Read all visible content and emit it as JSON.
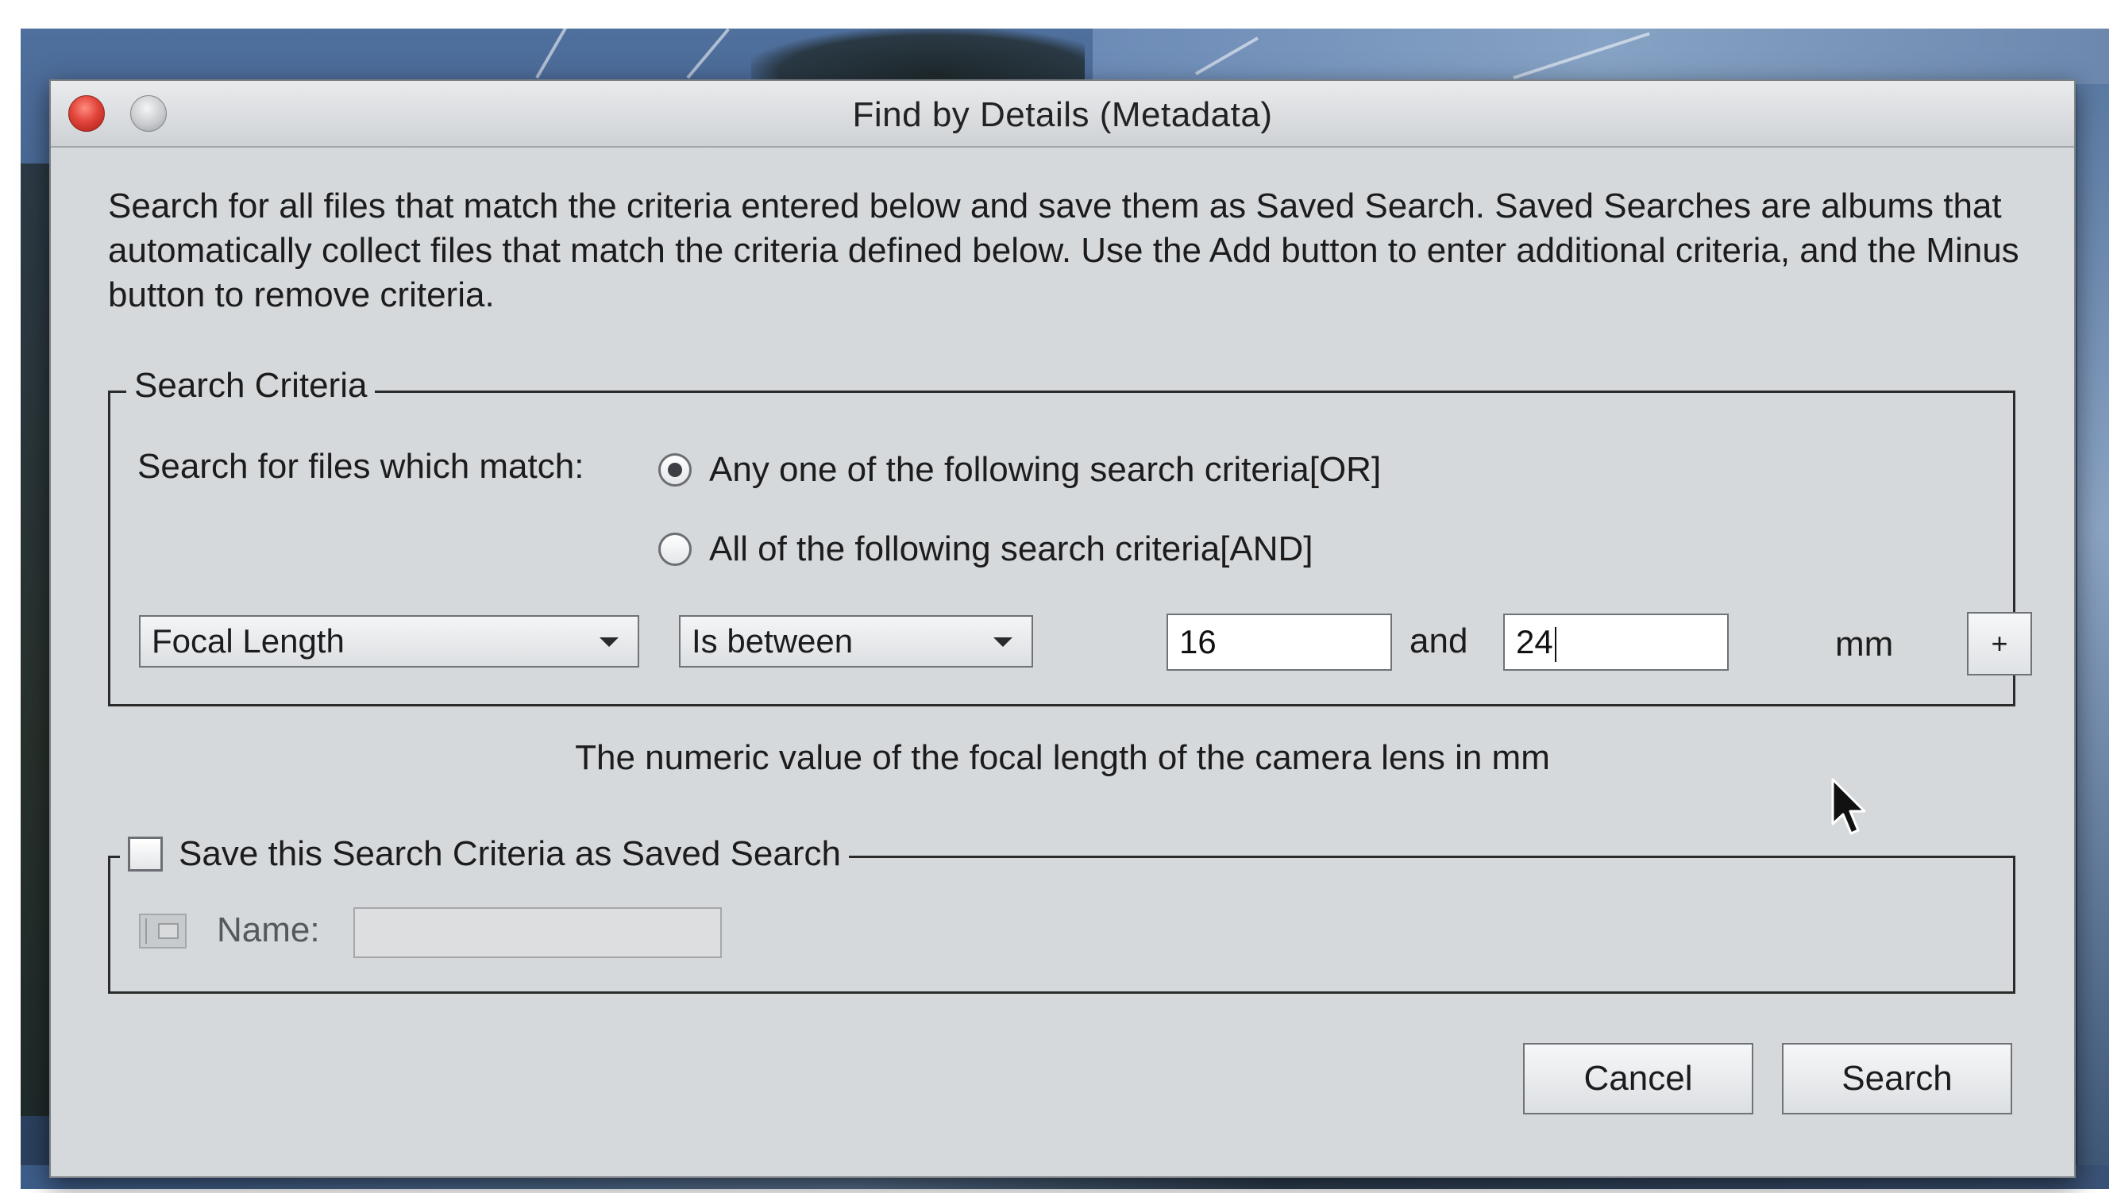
{
  "window": {
    "title": "Find by Details (Metadata)"
  },
  "intro_text": "Search for all files that match the criteria entered below and save them as Saved Search. Saved Searches are albums that automatically collect files that match the criteria defined below. Use the Add button to enter additional criteria, and the Minus button to remove criteria.",
  "search_criteria": {
    "legend": "Search Criteria",
    "match_label": "Search for files which match:",
    "options": [
      {
        "label": "Any one of the following search criteria[OR]",
        "selected": true
      },
      {
        "label": "All of the following search criteria[AND]",
        "selected": false
      }
    ],
    "row": {
      "field": "Focal Length",
      "operator": "Is between",
      "value_from": "16",
      "and_label": "and",
      "value_to": "24",
      "unit": "mm",
      "add_label": "+"
    }
  },
  "description": "The numeric value of the focal length of the camera lens in mm",
  "saved_search": {
    "checkbox_label": "Save this Search Criteria as Saved Search",
    "checked": false,
    "name_label": "Name:",
    "name_value": ""
  },
  "buttons": {
    "cancel": "Cancel",
    "search": "Search"
  },
  "colors": {
    "dialog_bg": "#d6d9dc",
    "close_button": "#e2443a"
  }
}
